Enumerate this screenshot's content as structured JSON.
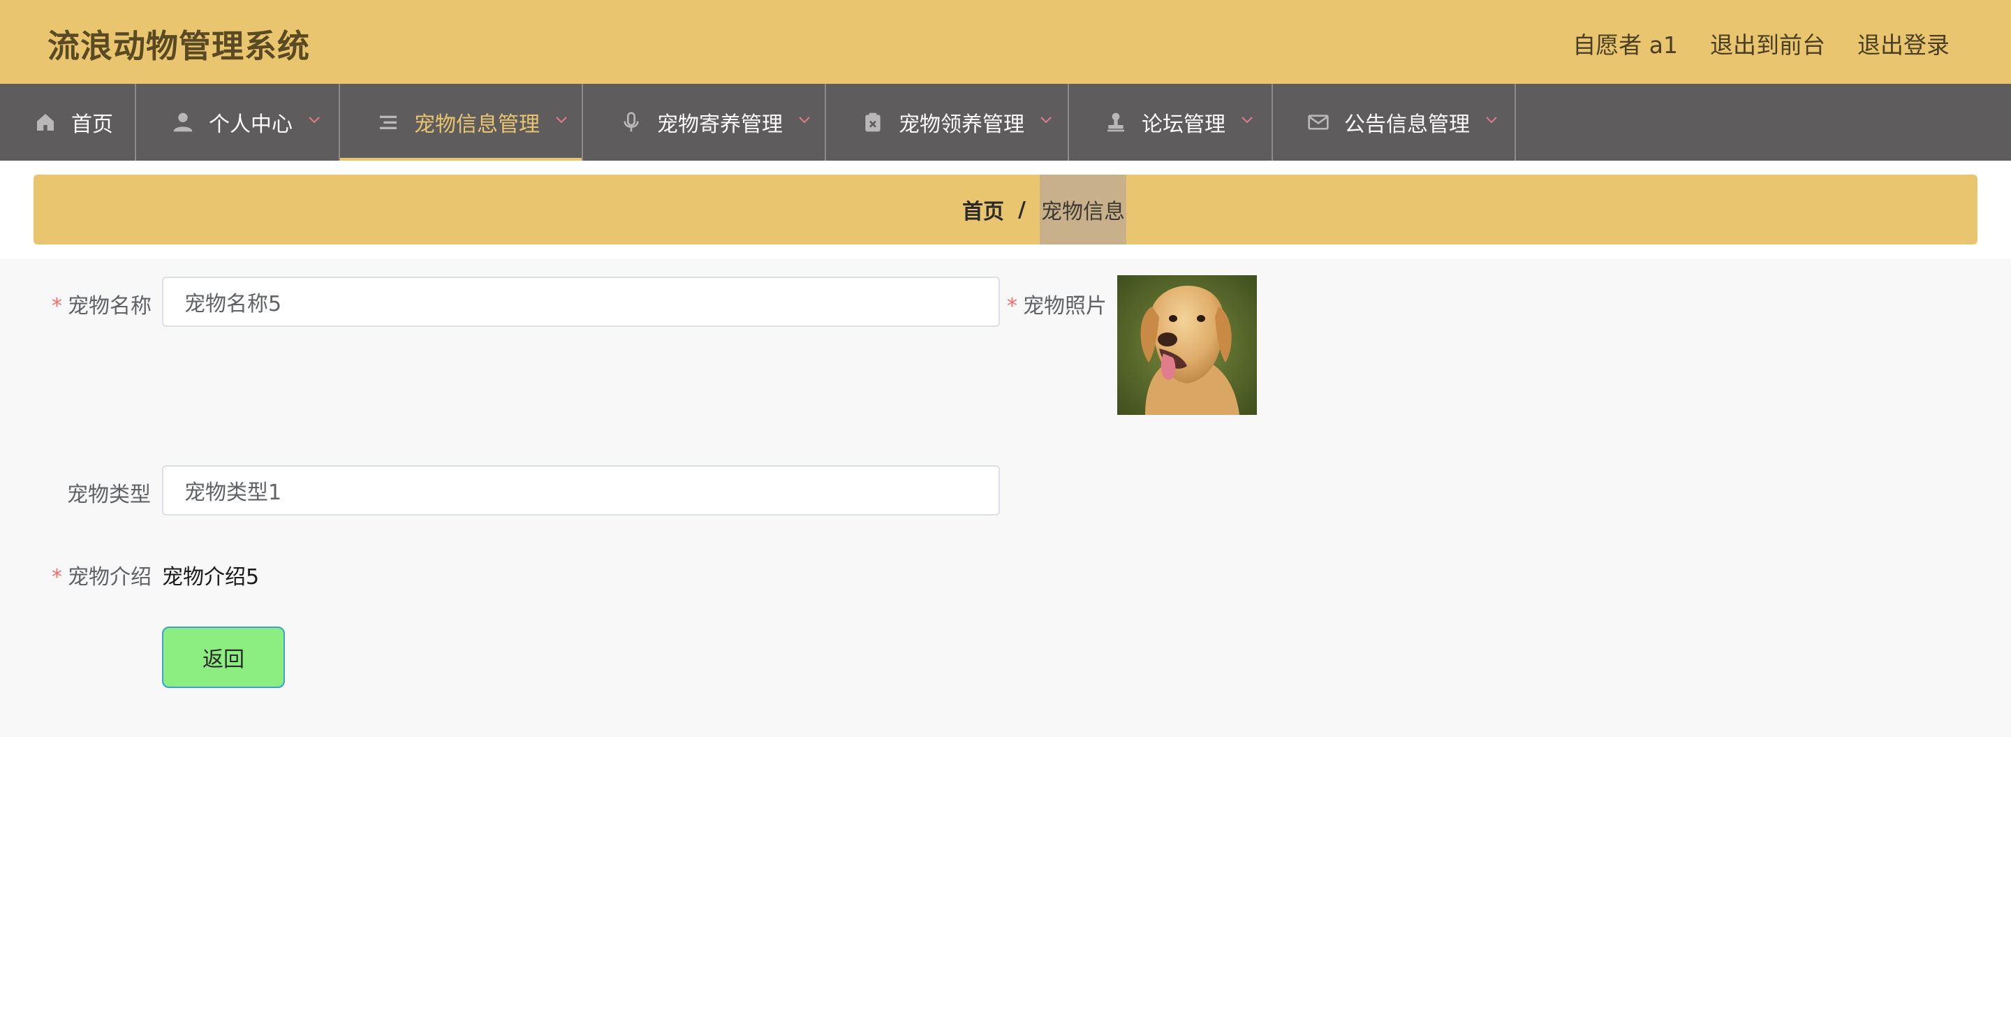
{
  "header": {
    "title": "流浪动物管理系统",
    "user_label": "自愿者 a1",
    "to_front_label": "退出到前台",
    "logout_label": "退出登录"
  },
  "nav": {
    "items": [
      {
        "label": "首页",
        "icon": "home-icon"
      },
      {
        "label": "个人中心",
        "icon": "user-icon"
      },
      {
        "label": "宠物信息管理",
        "icon": "list-icon",
        "active": true
      },
      {
        "label": "宠物寄养管理",
        "icon": "microphone-icon"
      },
      {
        "label": "宠物领养管理",
        "icon": "clipboard-icon"
      },
      {
        "label": "论坛管理",
        "icon": "stamp-icon"
      },
      {
        "label": "公告信息管理",
        "icon": "mail-icon"
      }
    ]
  },
  "breadcrumb": {
    "home": "首页",
    "separator": "/",
    "current": "宠物信息"
  },
  "form": {
    "name_label": "宠物名称",
    "name_value": "宠物名称5",
    "photo_label": "宠物照片",
    "type_label": "宠物类型",
    "type_value": "宠物类型1",
    "intro_label": "宠物介绍",
    "intro_value": "宠物介绍5",
    "required_mark": "*",
    "back_label": "返回"
  },
  "colors": {
    "header_bg": "#e8c56e",
    "nav_bg": "#5e5c5d",
    "accent": "#e8c56e",
    "back_button": "#8ced80"
  }
}
